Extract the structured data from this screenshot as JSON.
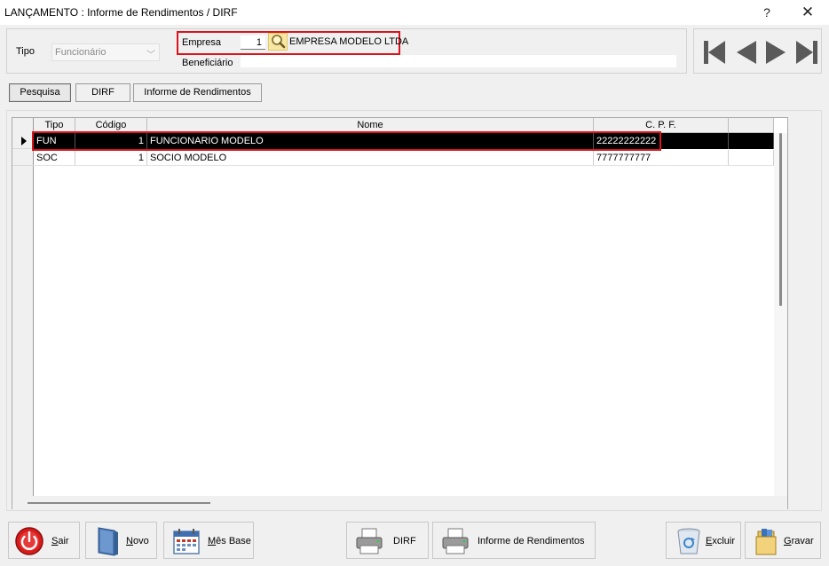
{
  "window": {
    "title": "LANÇAMENTO : Informe de Rendimentos / DIRF",
    "help_label": "?",
    "close_label": "✕"
  },
  "filter": {
    "tipo_label": "Tipo",
    "tipo_value": "Funcionário",
    "empresa_label": "Empresa",
    "empresa_code": "1",
    "empresa_name": "EMPRESA MODELO LTDA",
    "beneficiario_label": "Beneficiário",
    "beneficiario_value": ""
  },
  "tabs": [
    {
      "label": "Pesquisa",
      "active": true
    },
    {
      "label": "DIRF",
      "active": false
    },
    {
      "label": "Informe de Rendimentos",
      "active": false
    }
  ],
  "grid": {
    "columns": [
      "Tipo",
      "Código",
      "Nome",
      "C. P. F."
    ],
    "rows": [
      {
        "tipo": "FUN",
        "codigo": "1",
        "nome": "FUNCIONARIO MODELO",
        "cpf": "22222222222",
        "selected": true
      },
      {
        "tipo": "SOC",
        "codigo": "1",
        "nome": "SOCIO MODELO",
        "cpf": "7777777777",
        "selected": false
      }
    ]
  },
  "buttons": {
    "sair_u": "S",
    "sair_rest": "air",
    "novo_u": "N",
    "novo_rest": "ovo",
    "mesbase_u": "M",
    "mesbase_rest": "ês Base",
    "dirf": "DIRF",
    "informe": "Informe de Rendimentos",
    "excluir_u": "E",
    "excluir_rest": "xcluir",
    "gravar_u": "G",
    "gravar_rest": "ravar"
  },
  "colors": {
    "highlight_red": "#d9141c",
    "selected_row_bg": "#000000"
  },
  "icons": [
    "first-record-icon",
    "prev-record-icon",
    "next-record-icon",
    "last-record-icon",
    "search-icon",
    "power-icon",
    "new-document-icon",
    "calendar-icon",
    "printer-icon",
    "recycle-bin-icon",
    "save-folder-icon"
  ]
}
